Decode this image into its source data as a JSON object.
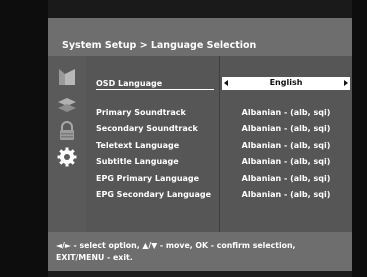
{
  "header": {
    "breadcrumb": "System Setup > Language Selection"
  },
  "icons": [
    "system-icon",
    "network-icon",
    "lock-icon",
    "settings-gear-icon"
  ],
  "settings": [
    {
      "label": "OSD Language",
      "value": "English"
    },
    {
      "label": "Primary Soundtrack",
      "value": "Albanian - (alb, sqi)"
    },
    {
      "label": "Secondary Soundtrack",
      "value": "Albanian - (alb, sqi)"
    },
    {
      "label": "Teletext Language",
      "value": "Albanian - (alb, sqi)"
    },
    {
      "label": "Subtitle Language",
      "value": "Albanian - (alb, sqi)"
    },
    {
      "label": "EPG Primary Language",
      "value": "Albanian - (alb, sqi)"
    },
    {
      "label": "EPG Secondary Language",
      "value": "Albanian - (alb, sqi)"
    }
  ],
  "footer": {
    "help_line1": "◄/► - select option, ▲/▼ - move, OK - confirm selection,",
    "help_line2": "EXIT/MENU - exit."
  },
  "colors": {
    "panel": "#525252",
    "header": "#6e6e6e",
    "highlight": "#ffffff"
  }
}
